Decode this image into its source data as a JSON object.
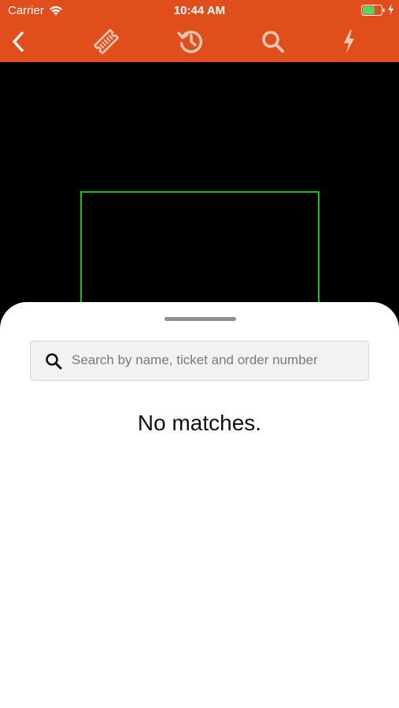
{
  "status_bar": {
    "carrier": "Carrier",
    "time": "10:44 AM"
  },
  "toolbar": {
    "icons": [
      "back-chevron-icon",
      "ticket-icon",
      "history-icon",
      "search-icon",
      "flash-icon"
    ]
  },
  "search": {
    "placeholder": "Search by name, ticket and order number",
    "value": ""
  },
  "results": {
    "empty_message": "No matches."
  },
  "colors": {
    "toolbar_bg": "#e04e1b",
    "scan_frame": "#16c216",
    "battery_fill": "#4cd964"
  }
}
